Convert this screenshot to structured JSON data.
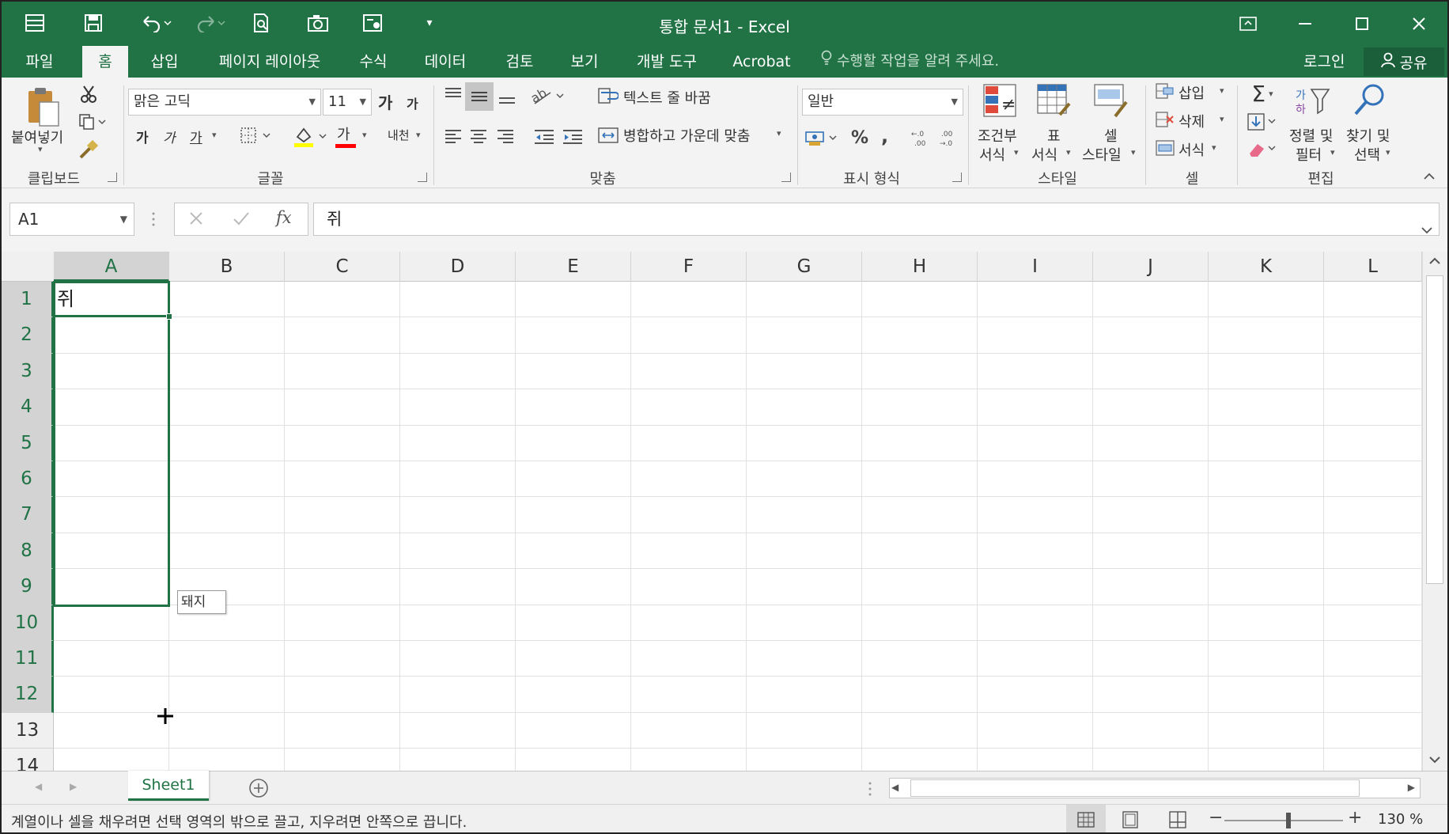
{
  "titlebar": {
    "title": "통합 문서1 - Excel"
  },
  "tabs": [
    "파일",
    "홈",
    "삽입",
    "페이지 레이아웃",
    "수식",
    "데이터",
    "검토",
    "보기",
    "개발 도구",
    "Acrobat"
  ],
  "tell_me": "수행할 작업을 알려 주세요.",
  "login": "로그인",
  "share": "공유",
  "ribbon": {
    "clipboard": {
      "paste": "붙여넣기",
      "label": "클립보드"
    },
    "font": {
      "name": "맑은 고딕",
      "size": "11",
      "grow": "가",
      "shrink": "가",
      "bold": "가",
      "italic": "가",
      "underline": "가",
      "font_color": "가",
      "phonetic": "내천",
      "label": "글꼴"
    },
    "alignment": {
      "wrap_text": "텍스트 줄 바꿈",
      "merge_center": "병합하고 가운데 맞춤",
      "label": "맞춤"
    },
    "number": {
      "format": "일반",
      "percent": "%",
      "comma": ",",
      "label": "표시 형식"
    },
    "styles": {
      "conditional_line1": "조건부",
      "conditional_line2": "서식",
      "table_line1": "표",
      "table_line2": "서식",
      "cell_line1": "셀",
      "cell_line2": "스타일",
      "label": "스타일"
    },
    "cells": {
      "insert": "삽입",
      "delete": "삭제",
      "format": "서식",
      "label": "셀"
    },
    "editing": {
      "sort_line1": "정렬 및",
      "sort_line2": "필터",
      "find_line1": "찾기 및",
      "find_line2": "선택",
      "label": "편집"
    }
  },
  "formula_bar": {
    "name_box": "A1",
    "fx": "fx",
    "content": "쥐"
  },
  "grid": {
    "columns": [
      "A",
      "B",
      "C",
      "D",
      "E",
      "F",
      "G",
      "H",
      "I",
      "J",
      "K",
      "L"
    ],
    "rows": [
      "1",
      "2",
      "3",
      "4",
      "5",
      "6",
      "7",
      "8",
      "9",
      "10",
      "11",
      "12",
      "13",
      "14"
    ],
    "cell_a1": "쥐",
    "fill_tooltip": "돼지"
  },
  "sheet_tab": "Sheet1",
  "status": {
    "message": "계열이나 셀을 채우려면 선택 영역의 밖으로 끌고, 지우려면 안쪽으로 끕니다.",
    "zoom": "130 %"
  }
}
